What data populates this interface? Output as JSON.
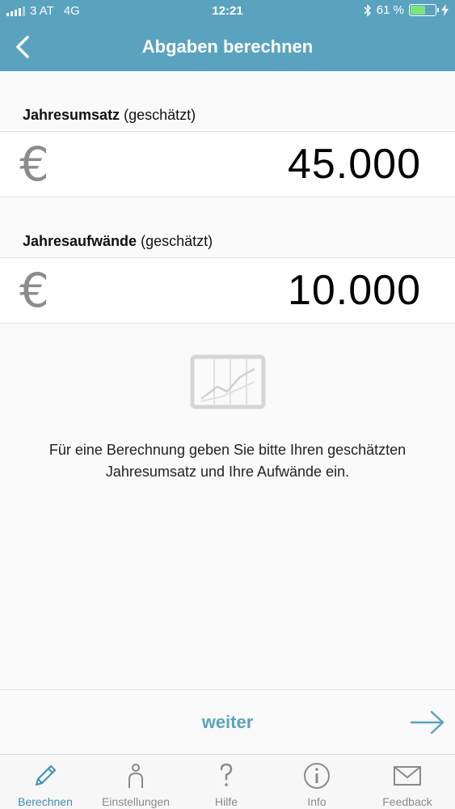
{
  "status": {
    "carrier": "3 AT",
    "network": "4G",
    "time": "12:21",
    "battery": "61 %",
    "battery_level": 0.61
  },
  "nav": {
    "title": "Abgaben berechnen",
    "back_icon": "chevron-left-icon"
  },
  "form": {
    "revenue_label": "Jahresumsatz",
    "revenue_suffix": "(geschätzt)",
    "revenue_value": "45.000",
    "expenses_label": "Jahresaufwände",
    "expenses_suffix": "(geschätzt)",
    "expenses_value": "10.000",
    "currency": "€"
  },
  "hint": {
    "line1": "Für eine Berechnung geben Sie bitte Ihren geschätzten",
    "line2": "Jahresumsatz und Ihre Aufwände ein."
  },
  "actions": {
    "next_label": "weiter"
  },
  "tabs": [
    {
      "label": "Berechnen",
      "icon": "pencil-icon"
    },
    {
      "label": "Einstellungen",
      "icon": "person-icon"
    },
    {
      "label": "Hilfe",
      "icon": "question-icon"
    },
    {
      "label": "Info",
      "icon": "info-icon"
    },
    {
      "label": "Feedback",
      "icon": "envelope-icon"
    }
  ],
  "colors": {
    "accent": "#5aa3bf",
    "active_tab": "#3f8fb1"
  }
}
